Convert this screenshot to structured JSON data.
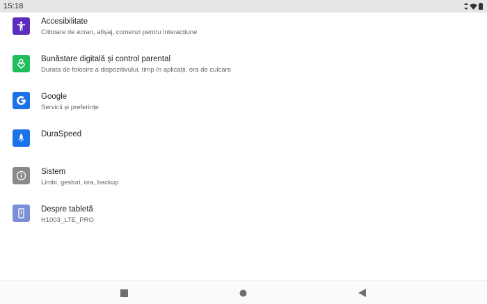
{
  "status_bar": {
    "time": "15:18",
    "icons": [
      "data-arrows-icon",
      "wifi-icon",
      "battery-icon"
    ]
  },
  "settings": {
    "items": [
      {
        "title": "Accesibilitate",
        "subtitle": "Cititoare de ecran, afișaj, comenzi pentru interacțiune",
        "icon": "accessibility-icon",
        "color": "#5b2dbd"
      },
      {
        "title": "Bunăstare digitală și control parental",
        "subtitle": "Durata de folosire a dispozitivului, timp în aplicații, ora de culcare",
        "icon": "digital-wellbeing-icon",
        "color": "#1fbe5a"
      },
      {
        "title": "Google",
        "subtitle": "Servicii și preferințe",
        "icon": "google-icon",
        "color": "#1a73e8"
      },
      {
        "title": "DuraSpeed",
        "subtitle": "",
        "icon": "rocket-icon",
        "color": "#1a73e8"
      },
      {
        "title": "Sistem",
        "subtitle": "Limbi, gesturi, ora, backup",
        "icon": "info-icon",
        "color": "#8a8a8a"
      },
      {
        "title": "Despre tabletă",
        "subtitle": "H1003_LTE_PRO",
        "icon": "tablet-icon",
        "color": "#7b8fd6"
      }
    ]
  },
  "nav_bar": {
    "buttons": [
      "recents-square-icon",
      "home-circle-icon",
      "back-triangle-icon"
    ]
  }
}
